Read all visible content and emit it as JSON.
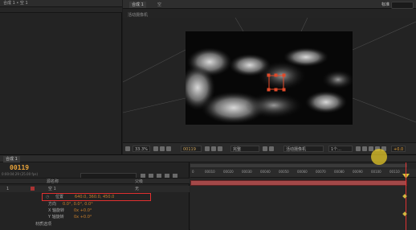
{
  "project": {
    "header": "合成 1 • 空 1"
  },
  "viewer": {
    "tabs": [
      "合成 1",
      "空"
    ],
    "workspace": "标准",
    "label": "活动摄像机",
    "toolbar": {
      "zoom": "33.3%",
      "timecode": "00119",
      "resolution": "完整",
      "camera": "活动摄像机",
      "views": "1个...",
      "exposure": "+0.0"
    }
  },
  "timeline": {
    "tab": "合成 1",
    "timecode": "00119",
    "fps": "0:00:04:29 (25.00 fps)",
    "columns": {
      "source": "源名称",
      "parent": "父级",
      "none": "无"
    },
    "layers": [
      {
        "index": "1",
        "name": "空 1"
      }
    ],
    "properties": [
      {
        "name": "位置",
        "value": "640.0, 360.0, 450.0"
      },
      {
        "name": "方向",
        "value": "0.0°, 0.0°, 0.0°"
      },
      {
        "name": "X 轴旋转",
        "value": "0x +0.0°"
      },
      {
        "name": "Y 轴旋转",
        "value": "0x +0.0°"
      },
      {
        "name": "材质选项",
        "value": ""
      }
    ],
    "ruler_ticks": [
      "0",
      "00010",
      "00020",
      "00030",
      "00040",
      "00050",
      "00060",
      "00070",
      "00080",
      "00090",
      "00100",
      "00110"
    ]
  },
  "colors": {
    "accent_orange": "#e8a33a",
    "layer_bar": "#a34848",
    "highlight_box": "#e03030",
    "cursor_highlight": "#e6c828"
  }
}
